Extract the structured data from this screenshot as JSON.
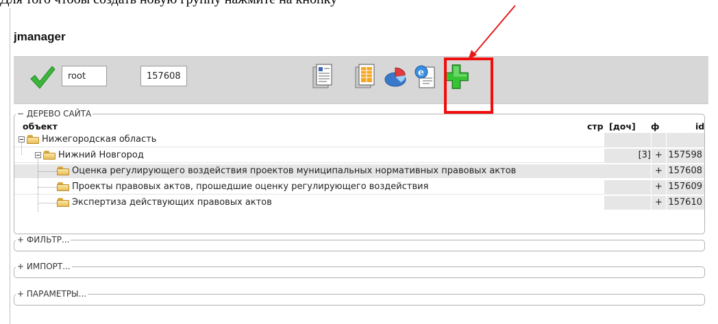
{
  "caption": "Для того чтобы создать новую группу нажмите на кнопку",
  "app": {
    "title": "jmanager"
  },
  "toolbar": {
    "user_value": "root",
    "id_value": "157608",
    "tools": [
      "document-icon",
      "table-document-icon",
      "pie-chart-icon",
      "web-page-icon",
      "add-icon"
    ]
  },
  "tree": {
    "legend": "− ДЕРЕВО САЙТА",
    "headers": {
      "object": "объект",
      "str": "стр",
      "doc": "[доч]",
      "f": "ф",
      "id": "id"
    },
    "rows": [
      {
        "label": "Нижегородская область",
        "doc": "",
        "f": "",
        "id": ""
      },
      {
        "label": "Нижний Новгород",
        "doc": "[3]",
        "f": "+",
        "id": "157598"
      },
      {
        "label": "Оценка регулирующего воздействия проектов муниципальных нормативных правовых актов",
        "doc": "",
        "f": "+",
        "id": "157608"
      },
      {
        "label": "Проекты правовых актов, прошедшие оценку регулирующего воздействия",
        "doc": "",
        "f": "+",
        "id": "157609"
      },
      {
        "label": "Экспертиза действующих правовых актов",
        "doc": "",
        "f": "+",
        "id": "157610"
      }
    ]
  },
  "sections": {
    "filter": "+ ФИЛЬТР...",
    "import": "+ ИМПОРТ...",
    "params": "+ ПАРАМЕТРЫ..."
  },
  "colors": {
    "highlight": "#f20d0d",
    "toolbar": "#d7d7d7",
    "selected_row": "#e6e6e6"
  }
}
